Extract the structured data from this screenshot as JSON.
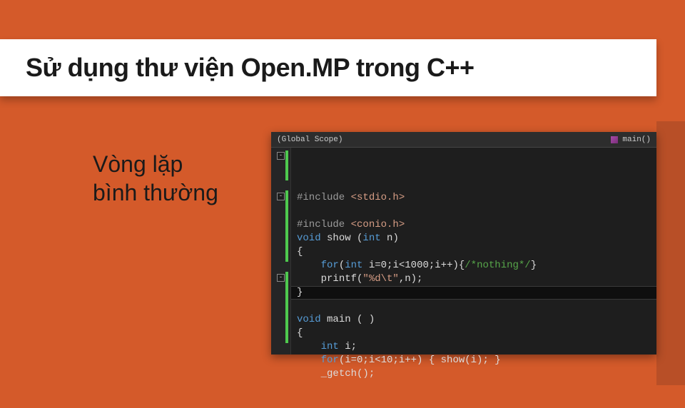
{
  "slide": {
    "title": "Sử dụng thư viện Open.MP trong  C++",
    "subtitle_line1": "Vòng lặp",
    "subtitle_line2": "bình thường"
  },
  "editor": {
    "scope_left": "(Global Scope)",
    "scope_right": "main()",
    "code": {
      "l1_pre": "#include ",
      "l1_str": "<stdio.h>",
      "l2": "",
      "l3_pre": "#include ",
      "l3_str": "<conio.h>",
      "l4_kw1": "void",
      "l4_fn": " show (",
      "l4_kw2": "int",
      "l4_rest": " n)",
      "l5": "{",
      "l6_kw": "for",
      "l6_a": "(",
      "l6_kw2": "int",
      "l6_b": " i=0;i<1000;i++){",
      "l6_cmt": "/*nothing*/",
      "l6_c": "}",
      "l7_a": "printf(",
      "l7_str": "\"%d\\t\"",
      "l7_b": ",n);",
      "l8": "}",
      "l9": "",
      "l10_kw": "void",
      "l10_rest": " main ( )",
      "l11": "{",
      "l12_kw": "int",
      "l12_rest": " i;",
      "l13_kw": "for",
      "l13_rest": "(i=0;i<10;i++) { show(i); }",
      "l14": "_getch();"
    }
  }
}
